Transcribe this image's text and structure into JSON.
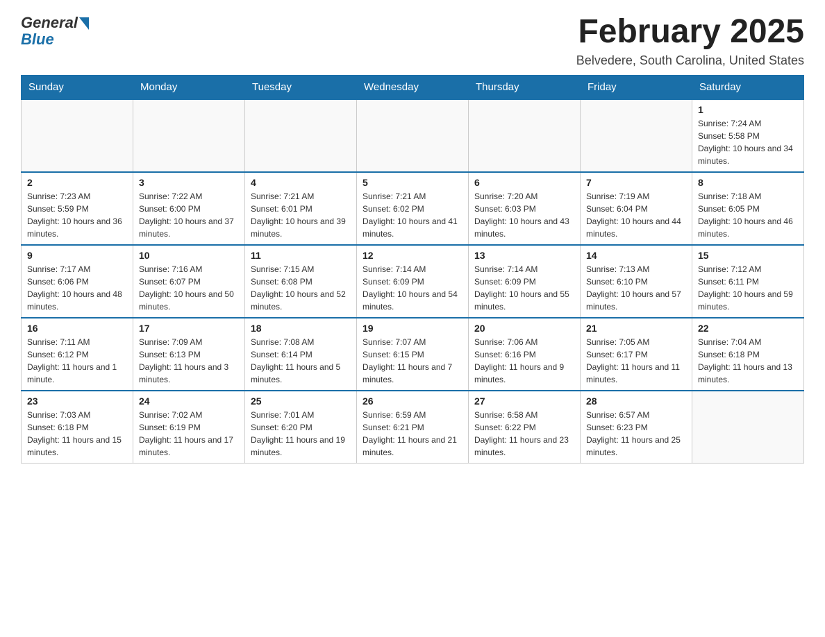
{
  "header": {
    "logo_general": "General",
    "logo_blue": "Blue",
    "month_year": "February 2025",
    "location": "Belvedere, South Carolina, United States"
  },
  "days_of_week": [
    "Sunday",
    "Monday",
    "Tuesday",
    "Wednesday",
    "Thursday",
    "Friday",
    "Saturday"
  ],
  "weeks": [
    [
      {
        "day": "",
        "info": ""
      },
      {
        "day": "",
        "info": ""
      },
      {
        "day": "",
        "info": ""
      },
      {
        "day": "",
        "info": ""
      },
      {
        "day": "",
        "info": ""
      },
      {
        "day": "",
        "info": ""
      },
      {
        "day": "1",
        "info": "Sunrise: 7:24 AM\nSunset: 5:58 PM\nDaylight: 10 hours and 34 minutes."
      }
    ],
    [
      {
        "day": "2",
        "info": "Sunrise: 7:23 AM\nSunset: 5:59 PM\nDaylight: 10 hours and 36 minutes."
      },
      {
        "day": "3",
        "info": "Sunrise: 7:22 AM\nSunset: 6:00 PM\nDaylight: 10 hours and 37 minutes."
      },
      {
        "day": "4",
        "info": "Sunrise: 7:21 AM\nSunset: 6:01 PM\nDaylight: 10 hours and 39 minutes."
      },
      {
        "day": "5",
        "info": "Sunrise: 7:21 AM\nSunset: 6:02 PM\nDaylight: 10 hours and 41 minutes."
      },
      {
        "day": "6",
        "info": "Sunrise: 7:20 AM\nSunset: 6:03 PM\nDaylight: 10 hours and 43 minutes."
      },
      {
        "day": "7",
        "info": "Sunrise: 7:19 AM\nSunset: 6:04 PM\nDaylight: 10 hours and 44 minutes."
      },
      {
        "day": "8",
        "info": "Sunrise: 7:18 AM\nSunset: 6:05 PM\nDaylight: 10 hours and 46 minutes."
      }
    ],
    [
      {
        "day": "9",
        "info": "Sunrise: 7:17 AM\nSunset: 6:06 PM\nDaylight: 10 hours and 48 minutes."
      },
      {
        "day": "10",
        "info": "Sunrise: 7:16 AM\nSunset: 6:07 PM\nDaylight: 10 hours and 50 minutes."
      },
      {
        "day": "11",
        "info": "Sunrise: 7:15 AM\nSunset: 6:08 PM\nDaylight: 10 hours and 52 minutes."
      },
      {
        "day": "12",
        "info": "Sunrise: 7:14 AM\nSunset: 6:09 PM\nDaylight: 10 hours and 54 minutes."
      },
      {
        "day": "13",
        "info": "Sunrise: 7:14 AM\nSunset: 6:09 PM\nDaylight: 10 hours and 55 minutes."
      },
      {
        "day": "14",
        "info": "Sunrise: 7:13 AM\nSunset: 6:10 PM\nDaylight: 10 hours and 57 minutes."
      },
      {
        "day": "15",
        "info": "Sunrise: 7:12 AM\nSunset: 6:11 PM\nDaylight: 10 hours and 59 minutes."
      }
    ],
    [
      {
        "day": "16",
        "info": "Sunrise: 7:11 AM\nSunset: 6:12 PM\nDaylight: 11 hours and 1 minute."
      },
      {
        "day": "17",
        "info": "Sunrise: 7:09 AM\nSunset: 6:13 PM\nDaylight: 11 hours and 3 minutes."
      },
      {
        "day": "18",
        "info": "Sunrise: 7:08 AM\nSunset: 6:14 PM\nDaylight: 11 hours and 5 minutes."
      },
      {
        "day": "19",
        "info": "Sunrise: 7:07 AM\nSunset: 6:15 PM\nDaylight: 11 hours and 7 minutes."
      },
      {
        "day": "20",
        "info": "Sunrise: 7:06 AM\nSunset: 6:16 PM\nDaylight: 11 hours and 9 minutes."
      },
      {
        "day": "21",
        "info": "Sunrise: 7:05 AM\nSunset: 6:17 PM\nDaylight: 11 hours and 11 minutes."
      },
      {
        "day": "22",
        "info": "Sunrise: 7:04 AM\nSunset: 6:18 PM\nDaylight: 11 hours and 13 minutes."
      }
    ],
    [
      {
        "day": "23",
        "info": "Sunrise: 7:03 AM\nSunset: 6:18 PM\nDaylight: 11 hours and 15 minutes."
      },
      {
        "day": "24",
        "info": "Sunrise: 7:02 AM\nSunset: 6:19 PM\nDaylight: 11 hours and 17 minutes."
      },
      {
        "day": "25",
        "info": "Sunrise: 7:01 AM\nSunset: 6:20 PM\nDaylight: 11 hours and 19 minutes."
      },
      {
        "day": "26",
        "info": "Sunrise: 6:59 AM\nSunset: 6:21 PM\nDaylight: 11 hours and 21 minutes."
      },
      {
        "day": "27",
        "info": "Sunrise: 6:58 AM\nSunset: 6:22 PM\nDaylight: 11 hours and 23 minutes."
      },
      {
        "day": "28",
        "info": "Sunrise: 6:57 AM\nSunset: 6:23 PM\nDaylight: 11 hours and 25 minutes."
      },
      {
        "day": "",
        "info": ""
      }
    ]
  ]
}
